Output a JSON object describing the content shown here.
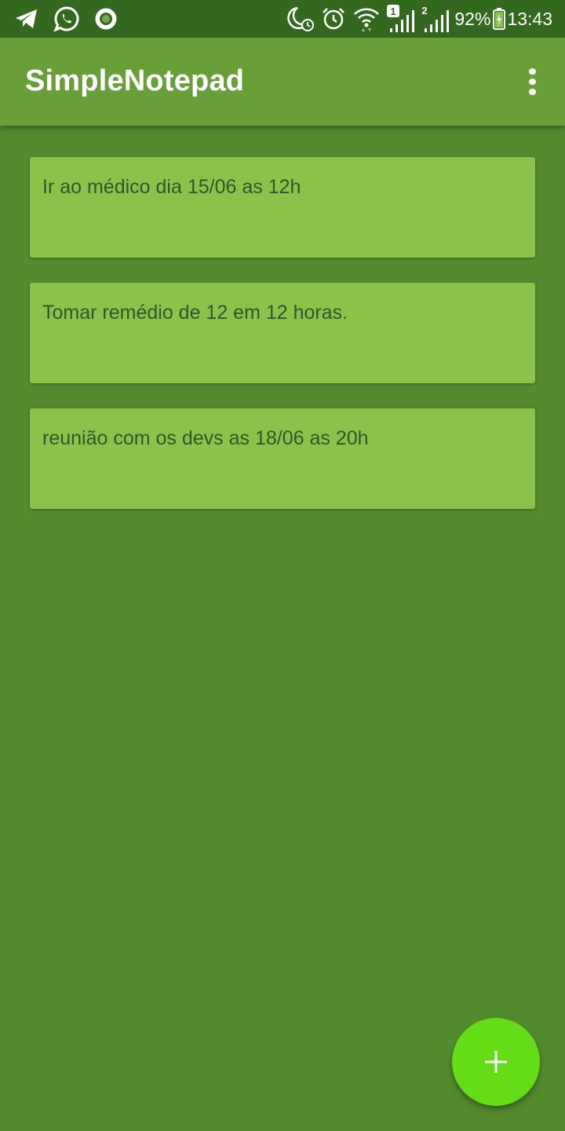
{
  "status_bar": {
    "battery_percent": "92%",
    "time": "13:43",
    "sim1_label": "1",
    "sim2_label": "2",
    "left_icons": [
      "telegram-icon",
      "whatsapp-icon",
      "record-icon"
    ],
    "right_icons": [
      "do-not-disturb-moon-icon",
      "alarm-clock-icon",
      "wifi-icon",
      "signal-sim1-icon",
      "signal-sim2-icon",
      "battery-charging-icon"
    ]
  },
  "app_bar": {
    "title": "SimpleNotepad",
    "menu_icon": "more-vertical-icon"
  },
  "notes": [
    {
      "text": "Ir ao médico dia 15/06 as 12h"
    },
    {
      "text": "Tomar remédio de 12 em 12 horas."
    },
    {
      "text": "reunião com os devs as 18/06 as 20h"
    }
  ],
  "fab": {
    "icon": "plus-icon"
  },
  "colors": {
    "status_bar": "#33691e",
    "app_bar": "#689f38",
    "background": "#548b2f",
    "note_card": "#8bc34a",
    "note_text": "#33552a",
    "fab": "#64dd17"
  }
}
